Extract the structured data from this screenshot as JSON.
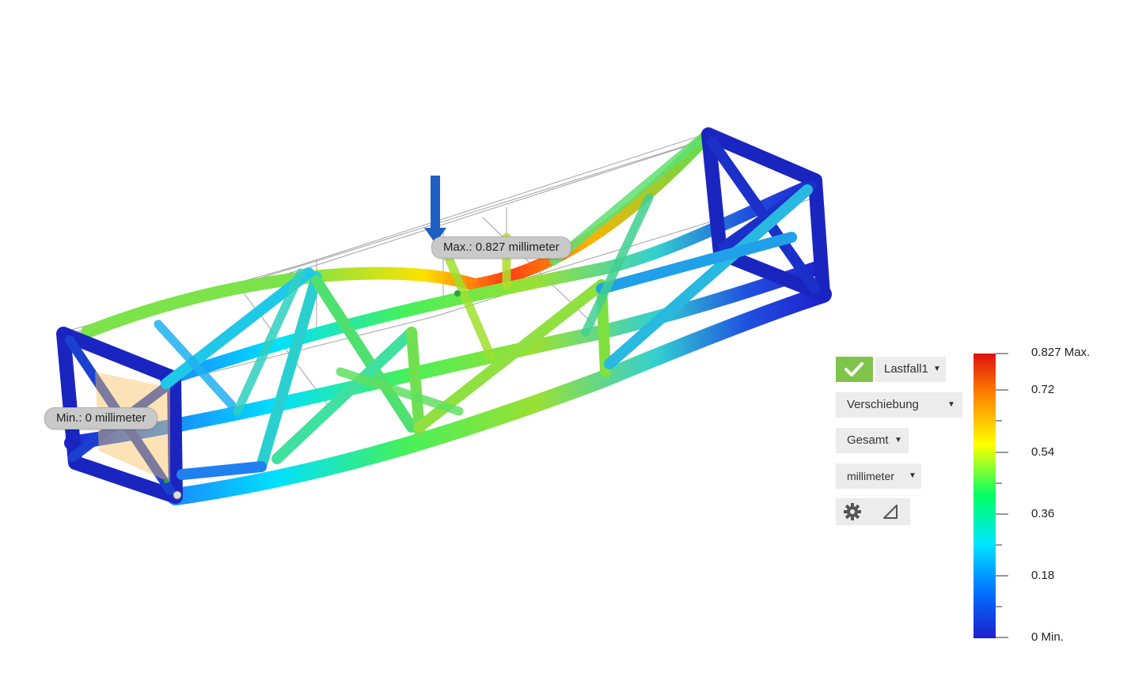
{
  "probes": {
    "max_label": "Max.: 0.827 millimeter",
    "min_label": "Min.: 0 millimeter"
  },
  "controls": {
    "apply_icon": "checkmark-icon",
    "load_case": "Lastfall1",
    "result_type": "Verschiebung",
    "component": "Gesamt",
    "unit": "millimeter",
    "settings_icon": "gear-icon",
    "deformation_icon": "deformation-scale-icon"
  },
  "legend": {
    "max_label": "0.827 Max.",
    "min_label": "0 Min.",
    "ticks": [
      "0.72",
      "0.54",
      "0.36",
      "0.18"
    ],
    "min_value": 0,
    "max_value": 0.827,
    "colors": [
      "#1f1fcc",
      "#0070ff",
      "#00e5ff",
      "#00ff66",
      "#ffff00",
      "#ff8800",
      "#e01010"
    ]
  },
  "colors": {
    "apply_green": "#7fc44a",
    "load_arrow": "#1f5fc4"
  }
}
